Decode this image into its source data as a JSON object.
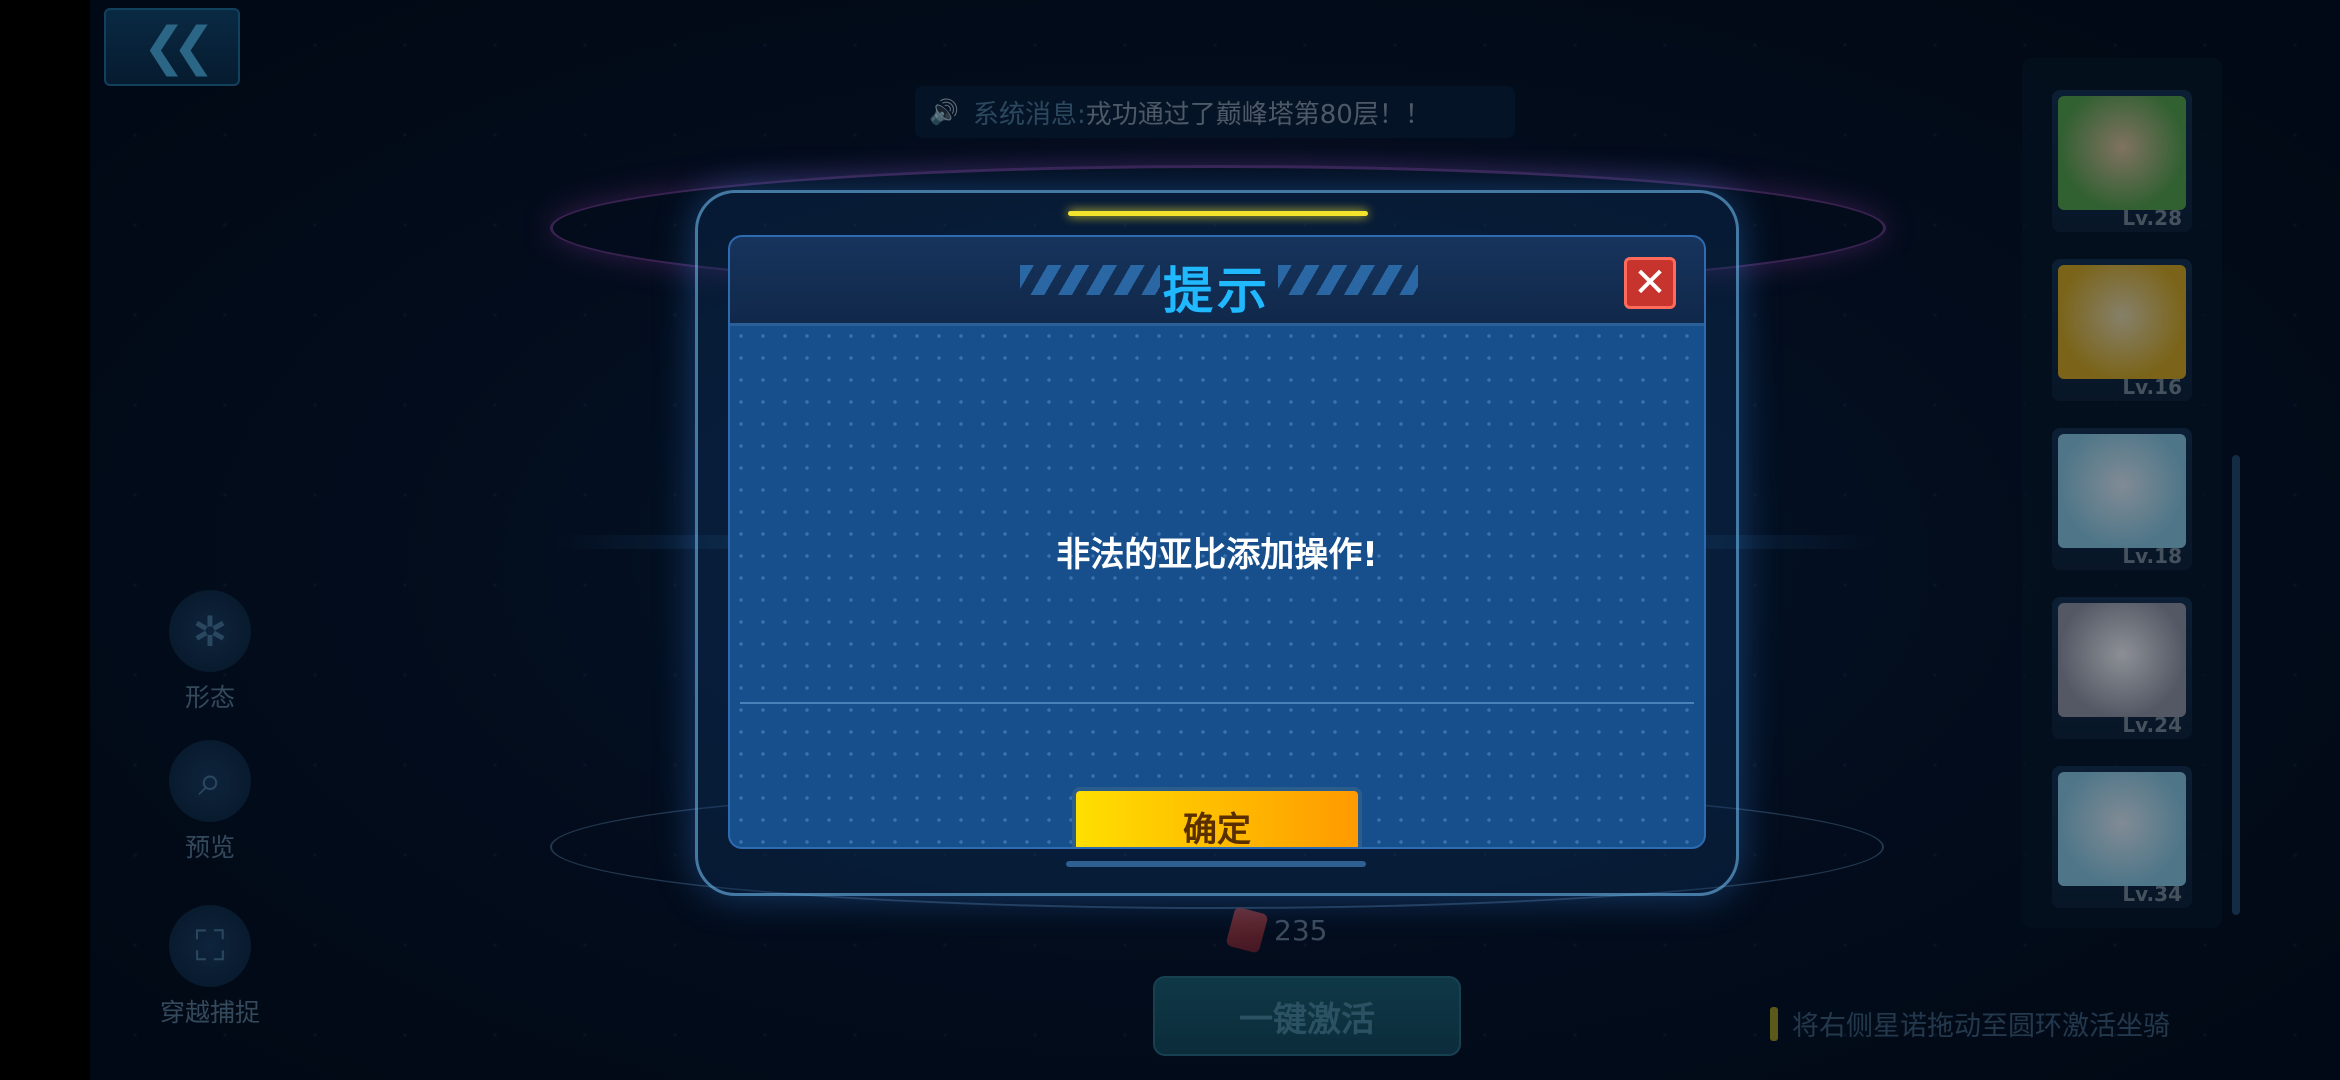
{
  "header": {
    "back_icon": "double-chevron-left-icon"
  },
  "notice": {
    "icon": "speaker-icon",
    "label": "系统消息:",
    "text": "戎功通过了巅峰塔第80层！！"
  },
  "left_menu": [
    {
      "icon": "form-icon",
      "label": "形态"
    },
    {
      "icon": "magnifier-icon",
      "label": "预览"
    },
    {
      "icon": "capture-frame-icon",
      "label": "穿越捕捉"
    }
  ],
  "cost": {
    "icon": "red-gem-icon",
    "amount": "235"
  },
  "activate_button": "一键激活",
  "hint_text": "将右侧星诺拖动至圆环激活坐骑",
  "mounts": [
    {
      "level": "Lv.28",
      "color": "#5aa84a"
    },
    {
      "level": "Lv.16",
      "color": "#e0b020"
    },
    {
      "level": "Lv.18",
      "color": "#8fd0e8"
    },
    {
      "level": "Lv.24",
      "color": "#e6e6e6"
    },
    {
      "level": "Lv.34",
      "color": "#8fd0e8"
    }
  ],
  "dialog": {
    "title": "提示",
    "close_icon": "close-x-icon",
    "message": "非法的亚比添加操作!",
    "ok_label": "确定"
  },
  "colors": {
    "title_blue": "#20b8ff",
    "ok_yellow": "#ffdf00",
    "ok_orange": "#ff9a00",
    "close_red": "#c7342e"
  }
}
